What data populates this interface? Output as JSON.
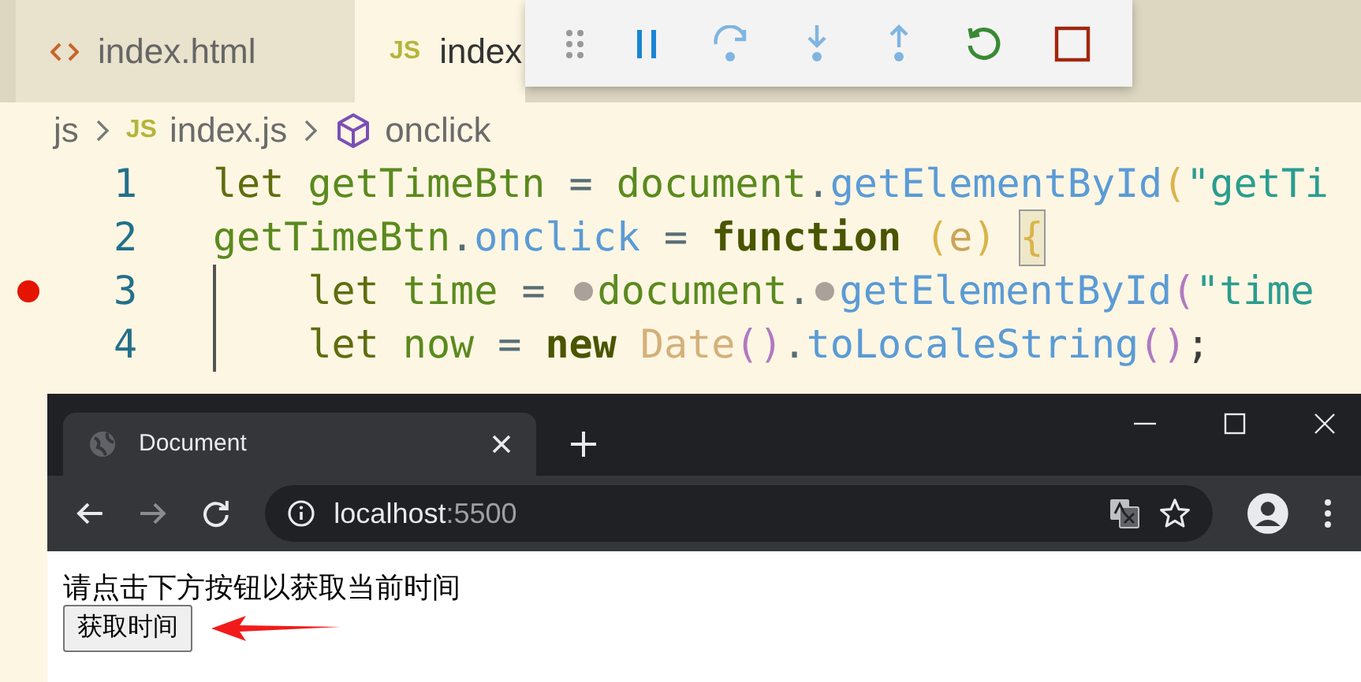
{
  "editor": {
    "tabs": [
      {
        "label": "index.html",
        "kind": "html",
        "selected": false
      },
      {
        "label": "index",
        "kind": "js",
        "badge": "JS",
        "selected": true
      }
    ],
    "breadcrumb": [
      {
        "label": "js",
        "kind": "folder"
      },
      {
        "label": "index.js",
        "kind": "file",
        "badge": "JS"
      },
      {
        "label": "onclick",
        "kind": "symbol"
      }
    ],
    "lines": [
      {
        "number": "1",
        "breakpoint": false,
        "indent_guide": false,
        "tokens": [
          {
            "kind": "keyword",
            "text": "let "
          },
          {
            "kind": "variable",
            "text": "getTimeBtn"
          },
          {
            "kind": "operator",
            "text": " = "
          },
          {
            "kind": "variable",
            "text": "document"
          },
          {
            "kind": "operator",
            "text": "."
          },
          {
            "kind": "method",
            "text": "getElementById"
          },
          {
            "kind": "paren",
            "text": "("
          },
          {
            "kind": "string",
            "text": "\"getTi"
          }
        ]
      },
      {
        "number": "2",
        "breakpoint": false,
        "indent_guide": false,
        "tokens": [
          {
            "kind": "variable",
            "text": "getTimeBtn"
          },
          {
            "kind": "operator",
            "text": "."
          },
          {
            "kind": "method",
            "text": "onclick"
          },
          {
            "kind": "operator",
            "text": " = "
          },
          {
            "kind": "keyword-bold",
            "text": "function "
          },
          {
            "kind": "paren",
            "text": "("
          },
          {
            "kind": "param",
            "text": "e"
          },
          {
            "kind": "paren",
            "text": ") "
          },
          {
            "kind": "bracket-match",
            "text": "{"
          }
        ]
      },
      {
        "number": "3",
        "breakpoint": true,
        "indent_guide": true,
        "tokens": [
          {
            "kind": "keyword",
            "text": "    let "
          },
          {
            "kind": "variable",
            "text": "time"
          },
          {
            "kind": "operator",
            "text": " = "
          },
          {
            "kind": "dot"
          },
          {
            "kind": "variable",
            "text": "document"
          },
          {
            "kind": "operator",
            "text": "."
          },
          {
            "kind": "dot"
          },
          {
            "kind": "method",
            "text": "getElementById"
          },
          {
            "kind": "paren2",
            "text": "("
          },
          {
            "kind": "string",
            "text": "\"time"
          }
        ]
      },
      {
        "number": "4",
        "breakpoint": false,
        "indent_guide": true,
        "tokens": [
          {
            "kind": "keyword",
            "text": "    let "
          },
          {
            "kind": "variable",
            "text": "now"
          },
          {
            "kind": "operator",
            "text": " = "
          },
          {
            "kind": "keyword-bold",
            "text": "new "
          },
          {
            "kind": "class",
            "text": "Date"
          },
          {
            "kind": "paren2",
            "text": "()"
          },
          {
            "kind": "operator",
            "text": "."
          },
          {
            "kind": "method",
            "text": "toLocaleString"
          },
          {
            "kind": "paren2",
            "text": "()"
          },
          {
            "kind": "punct",
            "text": ";"
          }
        ]
      }
    ]
  },
  "browser": {
    "tab": {
      "title": "Document"
    },
    "address": {
      "host": "localhost",
      "port": ":5500"
    },
    "page": {
      "text": "请点击下方按钮以获取当前时间",
      "button": "获取时间"
    }
  }
}
